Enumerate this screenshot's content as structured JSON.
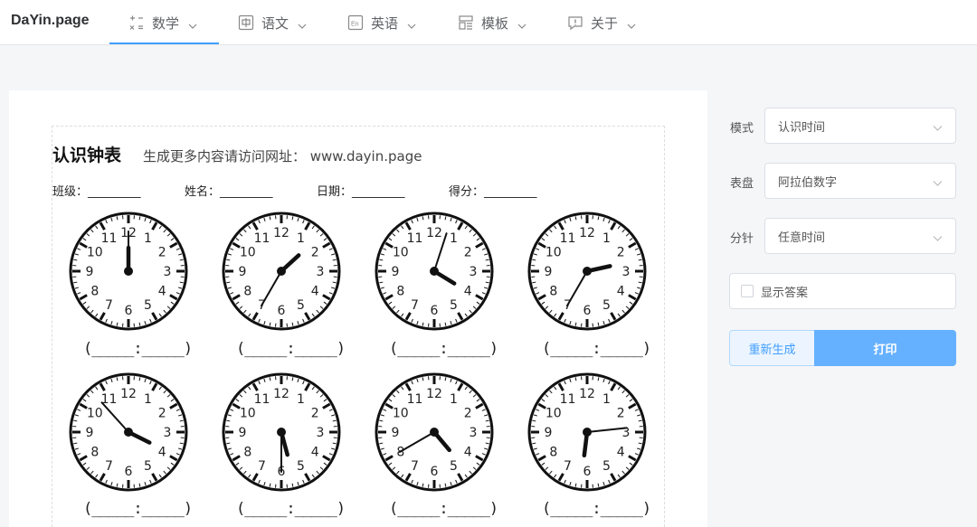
{
  "app": {
    "logo": "DaYin.page"
  },
  "nav": [
    {
      "label": "数学",
      "icon": "math-icon"
    },
    {
      "label": "语文",
      "icon": "chinese-char-icon"
    },
    {
      "label": "英语",
      "icon": "english-icon"
    },
    {
      "label": "模板",
      "icon": "template-icon"
    },
    {
      "label": "关于",
      "icon": "info-icon"
    }
  ],
  "active_nav": "数学",
  "sheet": {
    "title": "认识钟表",
    "subtitle": "生成更多内容请访问网址： www.dayin.page",
    "fields": [
      {
        "label": "班级：_________"
      },
      {
        "label": "姓名：_________"
      },
      {
        "label": "日期：_________"
      },
      {
        "label": "得分：_________"
      }
    ],
    "answer_blank": "(_____:_____)",
    "clocks": [
      {
        "hour": 12,
        "minute": 0
      },
      {
        "hour": 1,
        "minute": 35
      },
      {
        "hour": 4,
        "minute": 3
      },
      {
        "hour": 2,
        "minute": 35
      },
      {
        "hour": 3,
        "minute": 53
      },
      {
        "hour": 5,
        "minute": 30
      },
      {
        "hour": 4,
        "minute": 40
      },
      {
        "hour": 6,
        "minute": 14
      }
    ]
  },
  "settings": {
    "mode_label": "模式",
    "mode_value": "认识时间",
    "dial_label": "表盘",
    "dial_value": "阿拉伯数字",
    "minute_label": "分针",
    "minute_value": "任意时间",
    "show_answer_label": "显示答案",
    "show_answer_checked": false,
    "regenerate_label": "重新生成",
    "print_label": "打印"
  },
  "colors": {
    "accent": "#409eff",
    "print_button": "#66b1ff"
  }
}
